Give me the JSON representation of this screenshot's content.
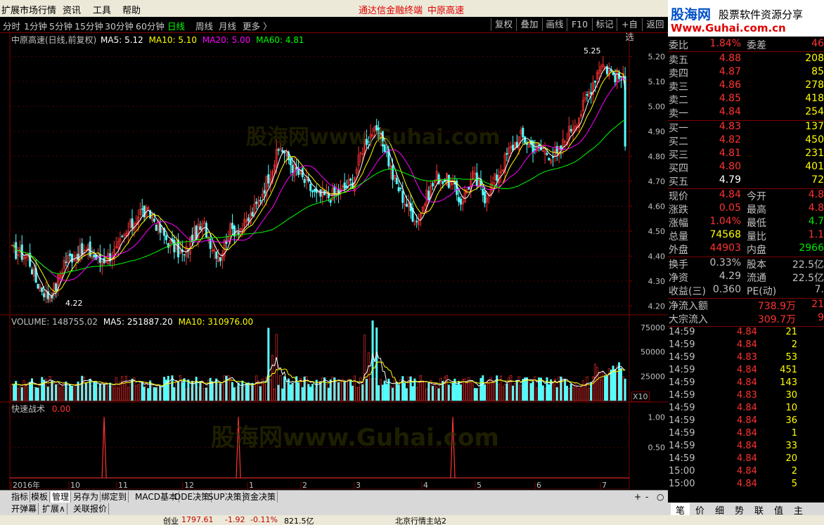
{
  "menu": {
    "items": [
      "扩展市场行情",
      "资讯",
      "工具",
      "帮助"
    ],
    "terminal_title": "通达信金融终端",
    "stock_title": "中原高速"
  },
  "logo": {
    "name": "股海网",
    "slogan": "股票软件资源分享",
    "url": "Www.Guhai.com.cn"
  },
  "toolbar": {
    "periods": [
      "分时",
      "1分钟",
      "5分钟",
      "15分钟",
      "30分钟",
      "60分钟",
      "日线",
      "周线",
      "月线",
      "更多 〉"
    ],
    "active": "日线",
    "buttons": [
      "复权",
      "叠加",
      "画线",
      "F10",
      "标记",
      "+自选",
      "返回"
    ]
  },
  "main_chart": {
    "header_name": "中原高速(日线,前复权)",
    "ma5": "MA5: 5.12",
    "ma10": "MA10: 5.10",
    "ma20": "MA20: 5.00",
    "ma60": "MA60: 4.81",
    "high_label": "5.25",
    "low_label": "4.22",
    "y_ticks": [
      "5.20",
      "5.10",
      "5.00",
      "4.90",
      "4.80",
      "4.70",
      "4.60",
      "4.50",
      "4.40",
      "4.30",
      "4.20"
    ]
  },
  "volume_chart": {
    "header": "VOLUME: 148755.02",
    "ma5": "MA5: 251887.20",
    "ma10": "MA10: 310976.00",
    "y_ticks": [
      "75000",
      "50000",
      "25000"
    ],
    "unit": "X10"
  },
  "indicator_chart": {
    "name": "快速战术",
    "value": "0.00",
    "y_ticks": [
      "1.00",
      "0.50"
    ]
  },
  "x_axis": {
    "labels": [
      "2016年",
      "10",
      "11",
      "12",
      "1",
      "2",
      "3",
      "4",
      "5",
      "6",
      "7"
    ]
  },
  "watermarks": [
    "股海网",
    "股海网www.Guhai.com"
  ],
  "chart_data": {
    "type": "candlestick",
    "y_range": [
      4.17,
      5.28
    ],
    "last_close": 4.84
  },
  "quote": {
    "weibi_label": "委比",
    "weibi": "1.84%",
    "weicha_label": "委差",
    "weicha": "46",
    "sells": [
      {
        "label": "卖五",
        "price": "4.88",
        "vol": "208"
      },
      {
        "label": "卖四",
        "price": "4.87",
        "vol": "85"
      },
      {
        "label": "卖三",
        "price": "4.86",
        "vol": "278"
      },
      {
        "label": "卖二",
        "price": "4.85",
        "vol": "418"
      },
      {
        "label": "卖一",
        "price": "4.84",
        "vol": "254"
      }
    ],
    "buys": [
      {
        "label": "买一",
        "price": "4.83",
        "vol": "137"
      },
      {
        "label": "买二",
        "price": "4.82",
        "vol": "450"
      },
      {
        "label": "买三",
        "price": "4.81",
        "vol": "231"
      },
      {
        "label": "买四",
        "price": "4.80",
        "vol": "401"
      },
      {
        "label": "买五",
        "price": "4.79",
        "vol": "72"
      }
    ],
    "stats": [
      {
        "l1": "现价",
        "v1": "4.84",
        "c1": "red",
        "l2": "今开",
        "v2": "4.8",
        "c2": "red"
      },
      {
        "l1": "涨跌",
        "v1": "0.05",
        "c1": "red",
        "l2": "最高",
        "v2": "4.8",
        "c2": "red"
      },
      {
        "l1": "涨幅",
        "v1": "1.04%",
        "c1": "red",
        "l2": "最低",
        "v2": "4.7",
        "c2": "grn"
      },
      {
        "l1": "总量",
        "v1": "74568",
        "c1": "yel",
        "l2": "量比",
        "v2": "1.1",
        "c2": "red"
      },
      {
        "l1": "外盘",
        "v1": "44903",
        "c1": "red",
        "l2": "内盘",
        "v2": "2966",
        "c2": "grn"
      }
    ],
    "stats2": [
      {
        "l1": "换手",
        "v1": "0.33%",
        "l2": "股本",
        "v2": "22.5亿"
      },
      {
        "l1": "净资",
        "v1": "4.29",
        "l2": "流通",
        "v2": "22.5亿"
      },
      {
        "l1": "收益(三)",
        "v1": "0.360",
        "l2": "PE(动)",
        "v2": "7."
      }
    ],
    "flows": [
      {
        "label": "净流入额",
        "value": "738.9万",
        "extra": "21"
      },
      {
        "label": "大宗流入",
        "value": "309.7万",
        "extra": "9"
      }
    ],
    "ticks": [
      {
        "t": "14:59",
        "p": "4.84",
        "q": "21",
        "c": "red"
      },
      {
        "t": "14:59",
        "p": "4.84",
        "q": "2",
        "c": "red"
      },
      {
        "t": "14:59",
        "p": "4.83",
        "q": "53",
        "c": "red"
      },
      {
        "t": "14:59",
        "p": "4.84",
        "q": "451",
        "c": "red"
      },
      {
        "t": "14:59",
        "p": "4.84",
        "q": "143",
        "c": "red"
      },
      {
        "t": "14:59",
        "p": "4.83",
        "q": "30",
        "c": "red"
      },
      {
        "t": "14:59",
        "p": "4.84",
        "q": "10",
        "c": "red"
      },
      {
        "t": "14:59",
        "p": "4.84",
        "q": "36",
        "c": "red"
      },
      {
        "t": "14:59",
        "p": "4.84",
        "q": "1",
        "c": "red"
      },
      {
        "t": "14:59",
        "p": "4.84",
        "q": "33",
        "c": "red"
      },
      {
        "t": "14:59",
        "p": "4.84",
        "q": "20",
        "c": "red"
      },
      {
        "t": "15:00",
        "p": "4.84",
        "q": "2",
        "c": "red"
      },
      {
        "t": "15:00",
        "p": "4.84",
        "q": "5",
        "c": "red"
      }
    ]
  },
  "bottom_tabs": [
    "指标",
    "模板",
    "管理",
    "另存为",
    "绑定到",
    "MACD基本",
    "DDE决策",
    "SUP决策",
    "资金决策"
  ],
  "bottom_tabs2": [
    "开弹幕",
    "扩展∧",
    "关联报价"
  ],
  "right_tabs": [
    "笔",
    "价",
    "细",
    "势",
    "联",
    "值",
    "主"
  ],
  "status": {
    "text": "创业",
    "val1": "1797.61",
    "val2": "-1.92",
    "val3": "-0.11%",
    "val4": "821.5亿",
    "site": "北京行情主站2"
  },
  "colors": {
    "up": "#ff3232",
    "down": "#54ffff",
    "ma5": "#ffffff",
    "ma10": "#ffff00",
    "ma20": "#ff00ff",
    "ma60": "#00ff00",
    "grid": "#800000"
  }
}
